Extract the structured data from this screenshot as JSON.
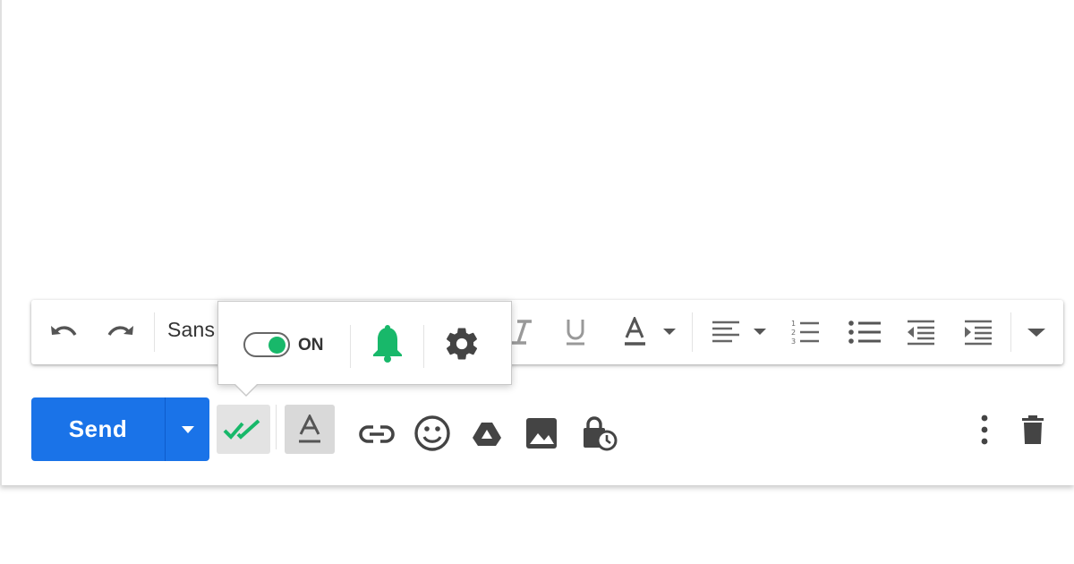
{
  "toolbar": {
    "font_name": "Sans",
    "icons": [
      "undo-icon",
      "redo-icon",
      "italic-icon",
      "underline-icon",
      "text-color-icon",
      "align-icon",
      "numbered-list-icon",
      "bulleted-list-icon",
      "indent-less-icon",
      "indent-more-icon",
      "more-formatting-icon"
    ]
  },
  "popup": {
    "toggle_label": "ON",
    "toggle_state": true,
    "accent_color": "#18b86a",
    "icons": [
      "bell-icon",
      "gear-icon"
    ]
  },
  "actions": {
    "send_label": "Send",
    "send_color": "#1a73e8",
    "icons": [
      "double-check-icon",
      "formatting-options-icon",
      "link-icon",
      "emoji-icon",
      "drive-icon",
      "photo-icon",
      "confidential-mode-icon",
      "more-options-icon",
      "trash-icon"
    ]
  }
}
